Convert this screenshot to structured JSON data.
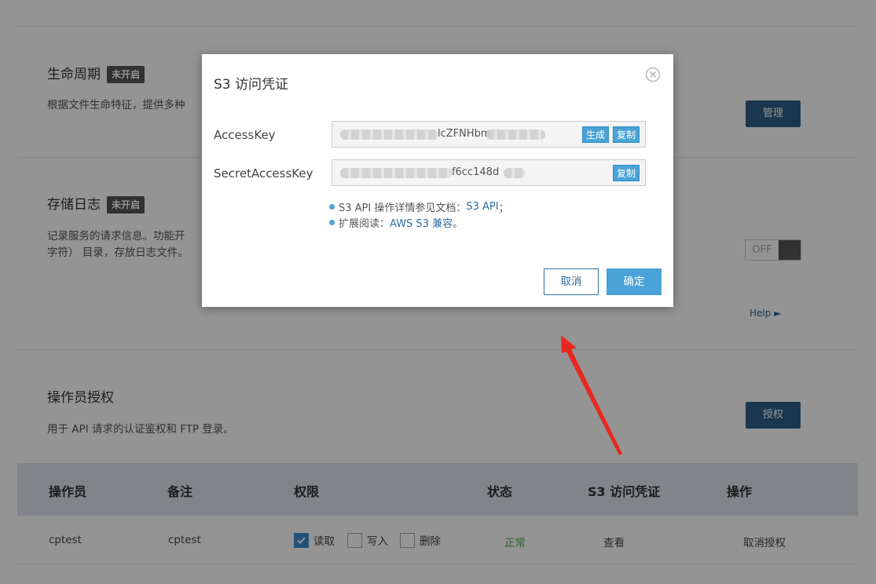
{
  "sections": {
    "lifecycle": {
      "title": "生命周期",
      "badge": "未开启",
      "desc": "根据文件生命特征，提供多种",
      "button": "管理"
    },
    "storage_log": {
      "title": "存储日志",
      "badge": "未开启",
      "desc_line1": "记录服务的请求信息。功能开",
      "desc_line2": "字符） 目录，存放日志文件。",
      "toggle": "OFF",
      "help": "Help ►"
    },
    "operators": {
      "title": "操作员授权",
      "desc": "用于 API 请求的认证鉴权和 FTP 登录。",
      "button": "授权"
    }
  },
  "table": {
    "headers": [
      "操作员",
      "备注",
      "权限",
      "状态",
      "S3 访问凭证",
      "操作"
    ],
    "row": {
      "operator": "cptest",
      "remark": "cptest",
      "perm_read": "读取",
      "perm_write": "写入",
      "perm_delete": "删除",
      "status": "正常",
      "s3": "查看",
      "action": "取消授权"
    }
  },
  "modal": {
    "title": "S3 访问凭证",
    "access_key_label": "AccessKey",
    "access_key_visible": "lcZFNHbm",
    "secret_key_label": "SecretAccessKey",
    "secret_key_visible": "f6cc148d",
    "generate": "生成",
    "copy": "复制",
    "note1_prefix": "S3 API 操作详情参见文档：",
    "note1_link": "S3 API",
    "note1_suffix": "；",
    "note2_prefix": "扩展阅读：",
    "note2_link": "AWS S3 兼容",
    "note2_suffix": "。",
    "cancel": "取消",
    "confirm": "确定"
  },
  "colors": {
    "accent": "#4aa3d6",
    "dark_button": "#2f5f8a",
    "arrow": "#e8281f",
    "status_ok": "#4caf50"
  }
}
